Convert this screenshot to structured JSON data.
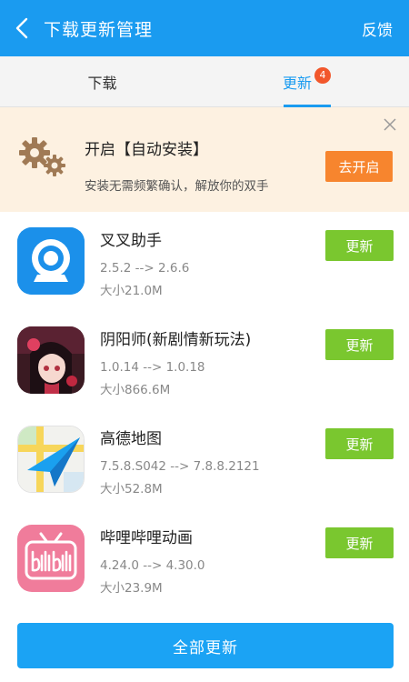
{
  "header": {
    "title": "下载更新管理",
    "feedback_label": "反馈",
    "back_icon": "chevron-left-icon"
  },
  "tabs": [
    {
      "label": "下载",
      "active": false
    },
    {
      "label": "更新",
      "active": true,
      "badge": "4"
    }
  ],
  "banner": {
    "title": "开启【自动安装】",
    "description": "安装无需频繁确认，解放你的双手",
    "button_label": "去开启",
    "icon": "gears-icon",
    "close_icon": "close-icon"
  },
  "apps": [
    {
      "name": "叉叉助手",
      "version": "2.5.2 --> 2.6.6",
      "size": "大小21.0M",
      "button_label": "更新"
    },
    {
      "name": "阴阳师(新剧情新玩法)",
      "version": "1.0.14 --> 1.0.18",
      "size": "大小866.6M",
      "button_label": "更新"
    },
    {
      "name": "高德地图",
      "version": "7.5.8.S042 --> 7.8.8.2121",
      "size": "大小52.8M",
      "button_label": "更新"
    },
    {
      "name": "哔哩哔哩动画",
      "version": "4.24.0 --> 4.30.0",
      "size": "大小23.9M",
      "button_label": "更新"
    }
  ],
  "footer": {
    "update_all_label": "全部更新"
  },
  "colors": {
    "primary": "#1a9bf0",
    "update_button": "#7ac72f",
    "enable_button": "#f7852e",
    "badge": "#f2572b",
    "banner_bg": "#fdf1e1"
  }
}
